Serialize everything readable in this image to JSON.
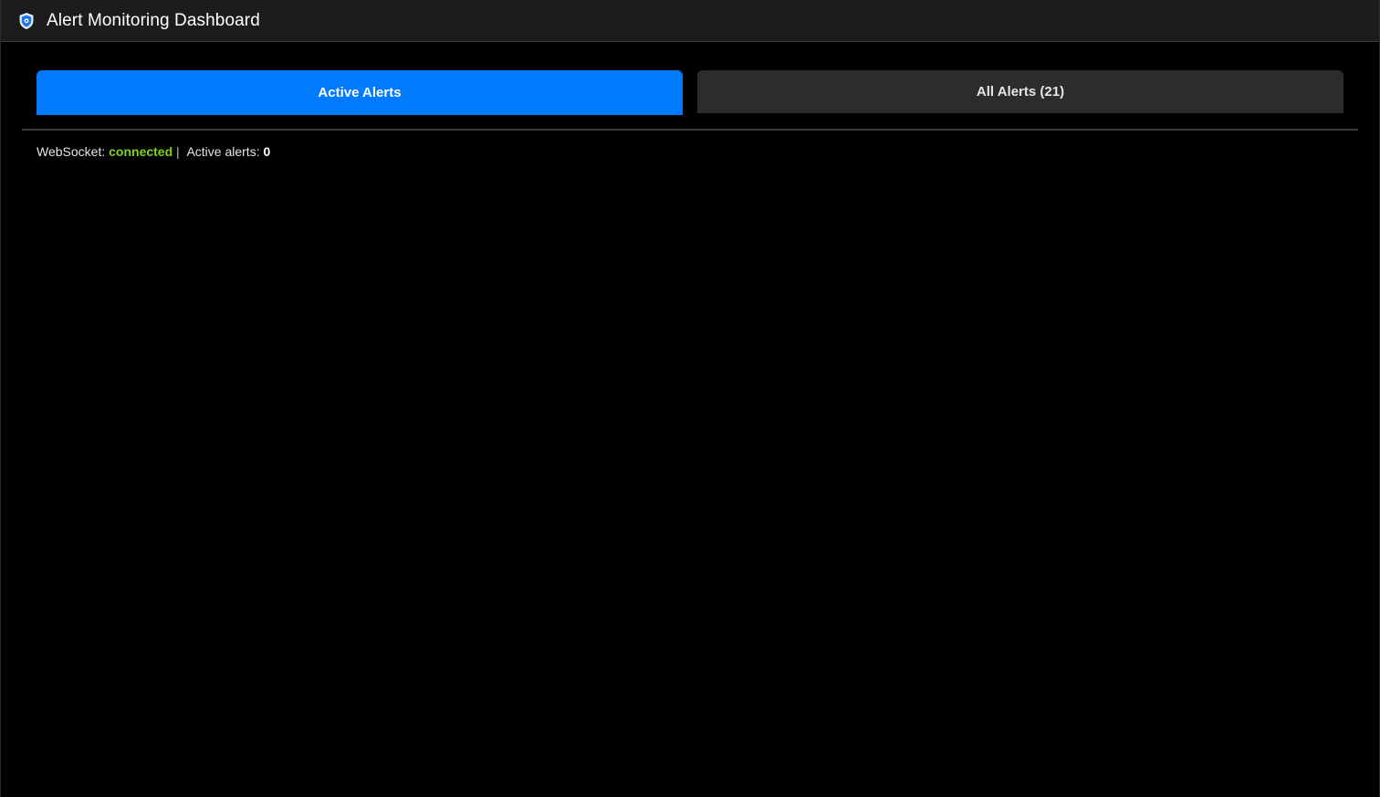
{
  "app": {
    "title": "Alert Monitoring Dashboard",
    "icon": "shield-icon"
  },
  "tabs": [
    {
      "label": "Active Alerts",
      "active": true
    },
    {
      "label": "All Alerts (21)",
      "active": false
    }
  ],
  "status": {
    "websocket_label": "WebSocket: ",
    "websocket_value": "connected",
    "separator": " |  ",
    "active_label": "Active alerts: ",
    "active_value": "0"
  },
  "colors": {
    "accent": "#007aff",
    "connected": "#7ed321",
    "background": "#000000",
    "titlebar": "#1c1c1e",
    "inactive_tab": "#2c2c2e"
  }
}
